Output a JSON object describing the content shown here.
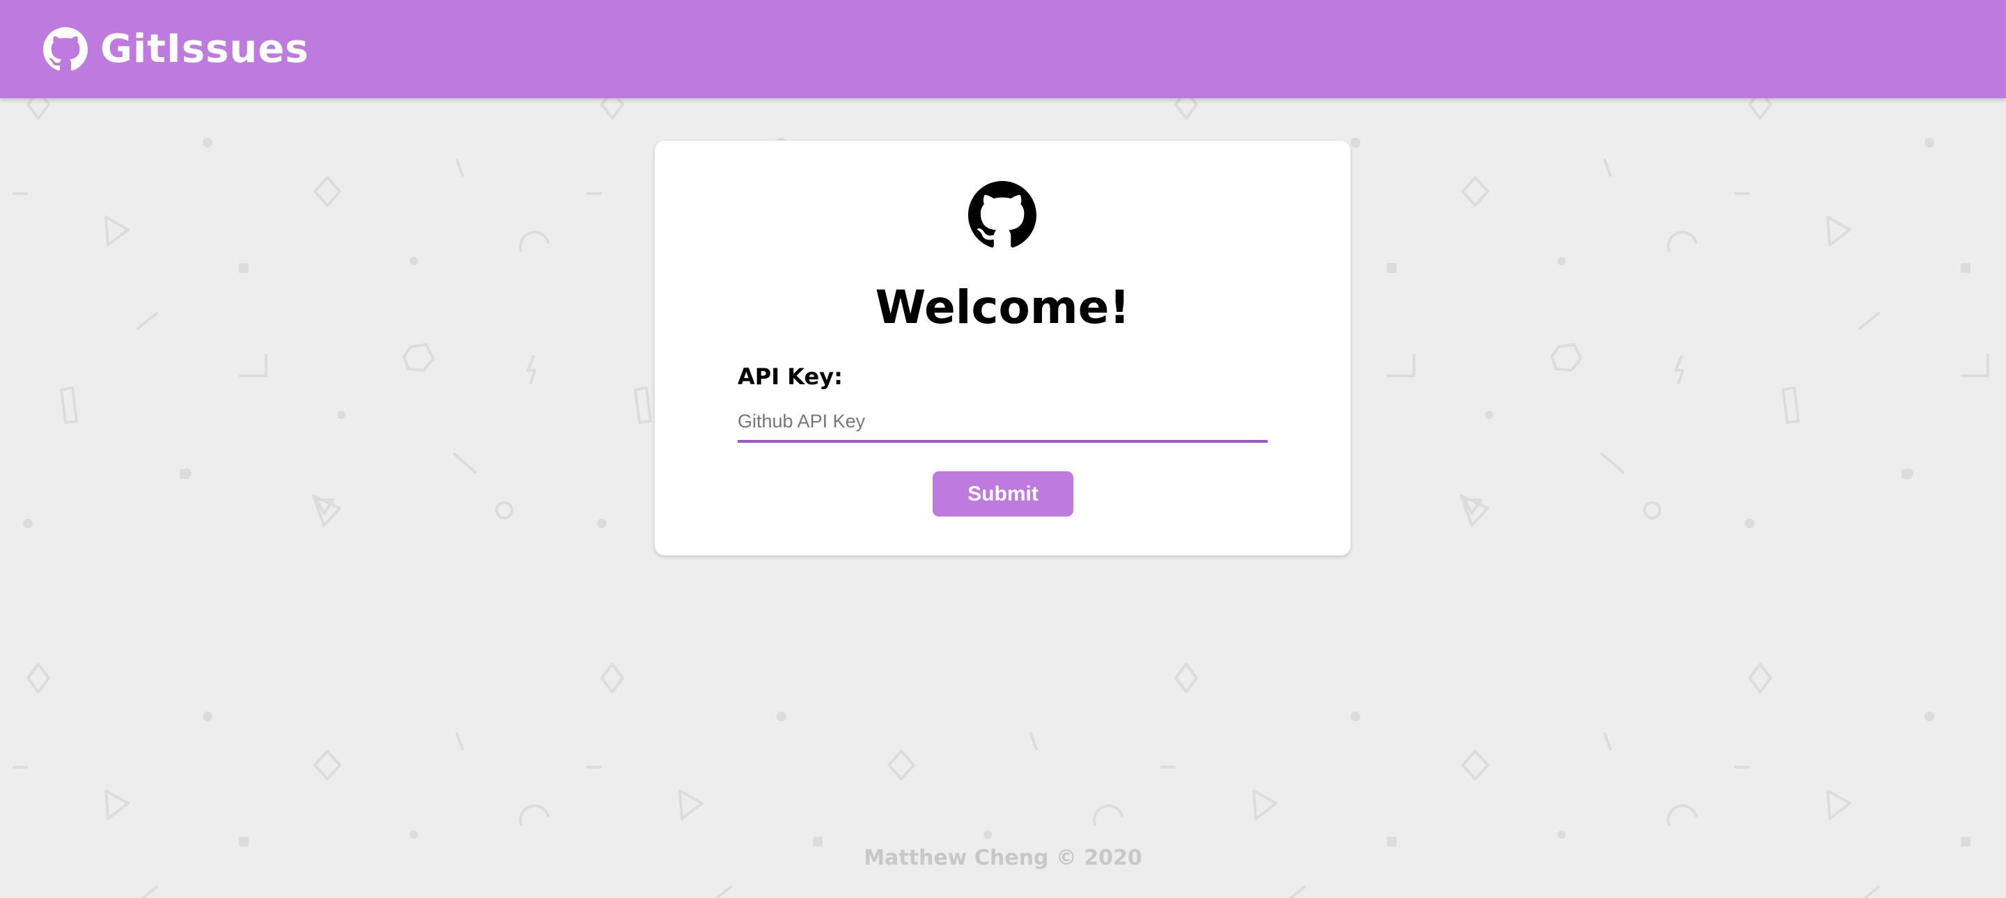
{
  "header": {
    "brand_name": "GitIssues",
    "brand_icon": "github-icon",
    "background_color": "#bf7ae0"
  },
  "login": {
    "logo_icon": "github-icon",
    "title": "Welcome!",
    "api_key_label": "API Key:",
    "api_key_placeholder": "Github API Key",
    "api_key_value": "",
    "submit_label": "Submit",
    "accent_color": "#bf7ae0",
    "input_underline_color": "#9a56cc"
  },
  "footer": {
    "text": "Matthew Cheng © 2020"
  },
  "colors": {
    "page_background": "#ededed",
    "pattern_stroke": "#dcdcdc",
    "footer_text": "#c8c8c8"
  }
}
